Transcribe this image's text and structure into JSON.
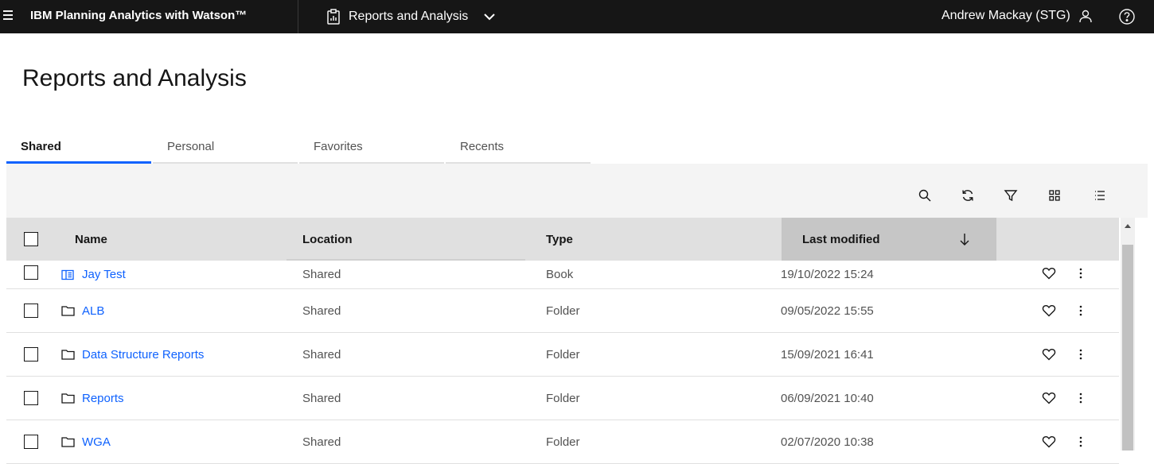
{
  "header": {
    "app_title": "IBM Planning Analytics with Watson™",
    "product_switcher_label": "Reports and Analysis",
    "user_name": "Andrew Mackay (STG)"
  },
  "page": {
    "title": "Reports and Analysis"
  },
  "tabs": [
    {
      "label": "Shared",
      "active": true
    },
    {
      "label": "Personal",
      "active": false
    },
    {
      "label": "Favorites",
      "active": false
    },
    {
      "label": "Recents",
      "active": false
    }
  ],
  "toolbar": {
    "icons": [
      "search-icon",
      "refresh-icon",
      "filter-icon",
      "grid-view-icon",
      "list-view-icon"
    ]
  },
  "table": {
    "columns": {
      "name": "Name",
      "location": "Location",
      "type": "Type",
      "last_modified": "Last modified"
    },
    "sort": {
      "column": "last_modified",
      "direction": "descending"
    },
    "rows": [
      {
        "name": "Jay Test",
        "icon": "book-icon",
        "location": "Shared",
        "type": "Book",
        "last_modified": "19/10/2022 15:24"
      },
      {
        "name": "ALB",
        "icon": "folder-icon",
        "location": "Shared",
        "type": "Folder",
        "last_modified": "09/05/2022 15:55"
      },
      {
        "name": "Data Structure Reports",
        "icon": "folder-icon",
        "location": "Shared",
        "type": "Folder",
        "last_modified": "15/09/2021 16:41"
      },
      {
        "name": "Reports",
        "icon": "folder-icon",
        "location": "Shared",
        "type": "Folder",
        "last_modified": "06/09/2021 10:40"
      },
      {
        "name": "WGA",
        "icon": "folder-icon",
        "location": "Shared",
        "type": "Folder",
        "last_modified": "02/07/2020 10:38"
      }
    ]
  },
  "colors": {
    "header_bg": "#161616",
    "link": "#0f62fe",
    "active_tab_underline": "#0f62fe",
    "table_header_bg": "#e0e0e0",
    "sorted_header_bg": "#c6c6c6",
    "toolbar_bg": "#f4f4f4"
  }
}
